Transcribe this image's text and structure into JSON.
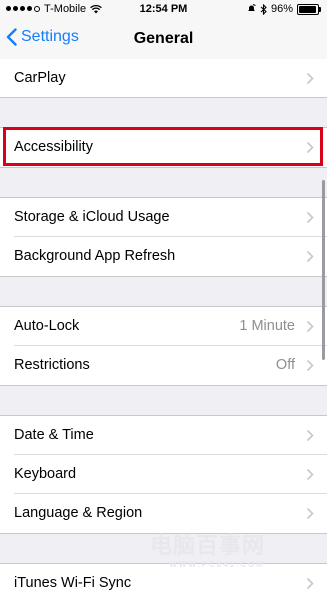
{
  "status_bar": {
    "carrier": "T-Mobile",
    "time": "12:54 PM",
    "battery": "96%",
    "battery_level": 0.96,
    "icons": [
      "signal-dots",
      "wifi-icon",
      "alarm-icon",
      "bluetooth-icon",
      "battery-icon"
    ]
  },
  "nav": {
    "back_label": "Settings",
    "title": "General"
  },
  "rows": {
    "carplay": "CarPlay",
    "accessibility": "Accessibility",
    "storage": "Storage & iCloud Usage",
    "background_refresh": "Background App Refresh",
    "auto_lock": "Auto-Lock",
    "auto_lock_value": "1 Minute",
    "restrictions": "Restrictions",
    "restrictions_value": "Off",
    "date_time": "Date & Time",
    "keyboard": "Keyboard",
    "language_region": "Language & Region",
    "itunes_wifi_sync": "iTunes Wi-Fi Sync"
  },
  "watermark": {
    "text": "电脑百事网",
    "url": "WWW.PC841.COM"
  },
  "colors": {
    "accent": "#157efb",
    "highlight": "#d8001a",
    "background": "#efeff4"
  }
}
